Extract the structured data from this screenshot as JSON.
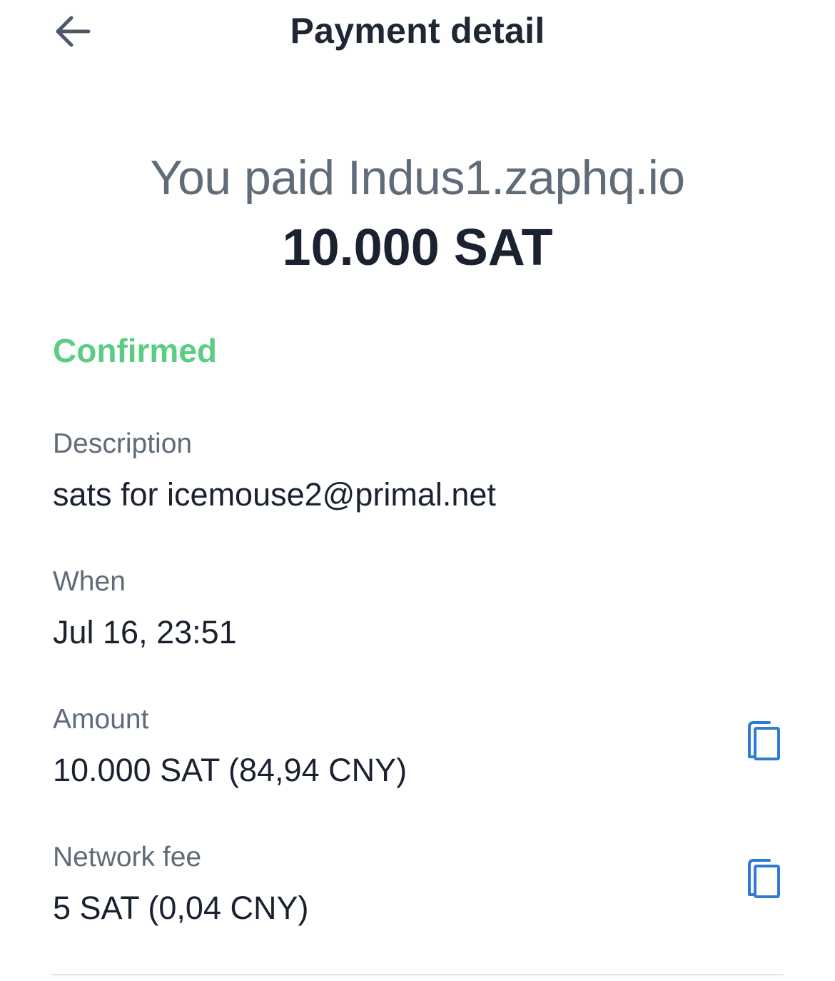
{
  "header": {
    "back_icon": "arrow-left-icon",
    "title": "Payment detail"
  },
  "summary": {
    "line": "You paid Indus1.zaphq.io",
    "amount": "10.000 SAT"
  },
  "status": {
    "label": "Confirmed",
    "color": "#5ccc84"
  },
  "fields": {
    "description": {
      "label": "Description",
      "value": "sats for icemouse2@primal.net"
    },
    "when": {
      "label": "When",
      "value": "Jul 16, 23:51"
    },
    "amount": {
      "label": "Amount",
      "value": "10.000 SAT (84,94 CNY)",
      "copy_icon": "copy-icon"
    },
    "network_fee": {
      "label": "Network fee",
      "value": "5 SAT (0,04 CNY)",
      "copy_icon": "copy-icon"
    }
  },
  "colors": {
    "accent_blue": "#2f7bd6",
    "text_primary": "#1a2230",
    "text_secondary": "#5f6b78"
  }
}
